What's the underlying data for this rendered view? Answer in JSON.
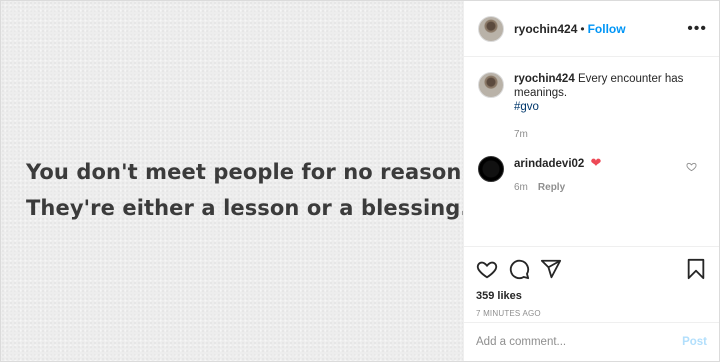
{
  "post": {
    "quote_lines": [
      "You don't meet people for no reason.",
      "They're either a lesson or a blessing."
    ]
  },
  "header": {
    "username": "ryochin424",
    "separator": "•",
    "follow_label": "Follow",
    "more_glyph": "•••"
  },
  "caption": {
    "username": "ryochin424",
    "text": "Every encounter has meanings.",
    "hashtag": "#gvo",
    "time": "7m"
  },
  "comments": [
    {
      "username": "arindadevi02",
      "emoji": "❤",
      "time": "6m",
      "reply_label": "Reply"
    }
  ],
  "actions": {
    "likes": "359 likes",
    "timestamp": "7 MINUTES AGO"
  },
  "add_comment": {
    "placeholder": "Add a comment...",
    "post_label": "Post"
  },
  "colors": {
    "accent": "#0095f6",
    "heart": "#ed4956",
    "hashtag": "#00376b",
    "post_disabled": "#b2dffc"
  },
  "icons": [
    "heart-icon",
    "comment-icon",
    "share-icon",
    "bookmark-icon",
    "more-icon",
    "small-heart-icon"
  ]
}
